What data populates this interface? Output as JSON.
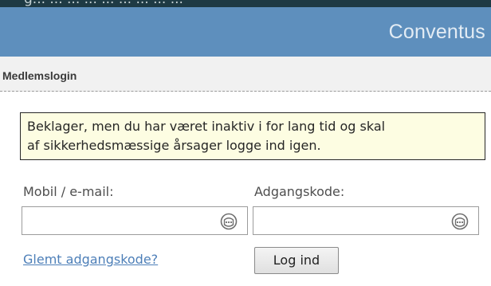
{
  "top_strip": {
    "text": "g... ... ... ... ... ... ... ... ..."
  },
  "header": {
    "brand": "Conventus"
  },
  "section": {
    "title": "Medlemslogin"
  },
  "notice": {
    "line1": "Beklager, men du har været inaktiv i for lang tid og skal",
    "line2": "af sikkerhedsmæssige årsager logge ind igen."
  },
  "form": {
    "username_label": "Mobil / e-mail:",
    "username_value": "",
    "password_label": "Adgangskode:",
    "password_value": "",
    "forgot_link": "Glemt adgangskode?",
    "login_button": "Log ind"
  },
  "icons": {
    "username_icon": "password-manager-icon",
    "password_icon": "password-manager-icon"
  },
  "colors": {
    "top_strip": "#1e3a44",
    "header": "#5e8fbd",
    "notice_bg": "#fdfde2",
    "link": "#4d7fb8"
  }
}
